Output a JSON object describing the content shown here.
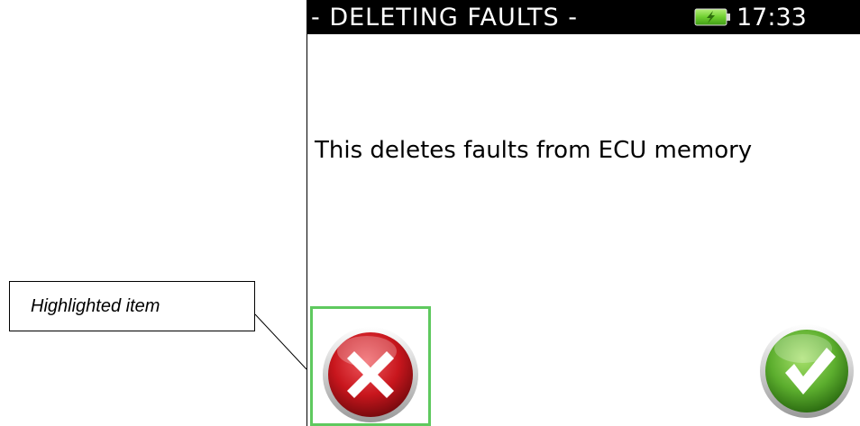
{
  "annotation": {
    "label": "Highlighted item"
  },
  "header": {
    "title": "- DELETING FAULTS -",
    "time": "17:33",
    "battery_icon": "battery-charging-icon"
  },
  "main": {
    "message": "This deletes faults from ECU memory"
  },
  "buttons": {
    "cancel_icon": "cancel-x-icon",
    "confirm_icon": "confirm-check-icon"
  },
  "colors": {
    "highlight": "#5fc95f",
    "cancel_red": "#c8161d",
    "confirm_green": "#5cae2e",
    "title_bar": "#000000"
  }
}
